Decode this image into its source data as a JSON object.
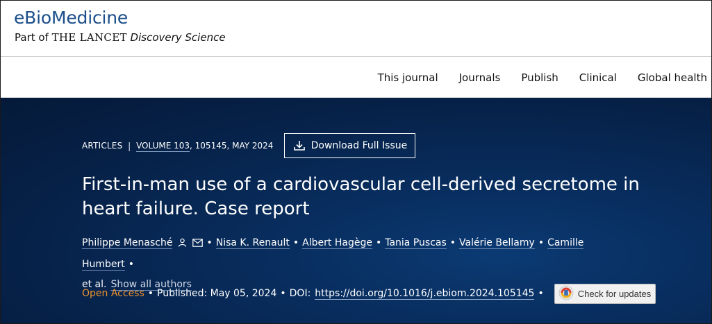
{
  "brand": {
    "title": "eBioMedicine",
    "sub_prefix": "Part of ",
    "sub_lancet": "THE LANCET",
    "sub_suffix": " Discovery Science"
  },
  "nav": {
    "items": [
      "This journal",
      "Journals",
      "Publish",
      "Clinical",
      "Global health"
    ]
  },
  "article": {
    "type": "ARTICLES",
    "volume": "VOLUME 103",
    "volume_rest": ", 105145, MAY 2024",
    "download_label": "Download Full Issue",
    "title": "First-in-man use of a cardiovascular cell-derived secretome in heart failure. Case report",
    "authors": [
      "Philippe Menasché",
      "Nisa K. Renault",
      "Albert Hagège",
      "Tania Puscas",
      "Valérie Bellamy",
      "Camille Humbert"
    ],
    "et_al": "et al.",
    "show_all": "Show all authors",
    "open_access": "Open Access",
    "published_label": "Published:",
    "published_date": "May 05, 2024",
    "doi_label": "DOI:",
    "doi_url": "https://doi.org/10.1016/j.ebiom.2024.105145",
    "check_updates": "Check for updates"
  },
  "colors": {
    "brand_blue": "#1b4e8a",
    "hero_bg": "#082c5c",
    "open_access": "#f0932b"
  },
  "icons": {
    "download": "download-icon",
    "person": "person-icon",
    "mail": "mail-icon",
    "crossmark": "crossmark-icon"
  }
}
